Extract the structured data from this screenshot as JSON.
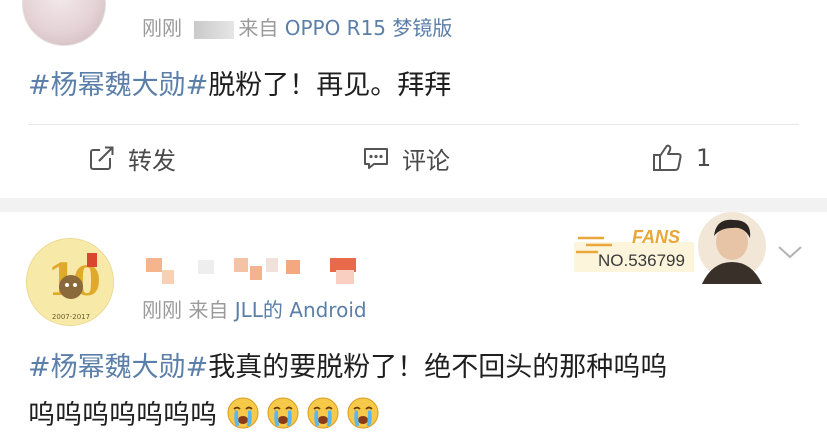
{
  "post1": {
    "time": "刚刚",
    "from_prefix": "来自",
    "device": "OPPO R15 梦镜版",
    "topic": "#杨幂魏大勋#",
    "text": "脱粉了！再见。拜拜",
    "actions": {
      "repost_label": "转发",
      "comment_label": "评论",
      "like_count": "1"
    }
  },
  "post2": {
    "time": "刚刚",
    "from_prefix": "来自",
    "device": "JLL的 Android",
    "avatar_years": "2007-2017",
    "badge": {
      "title": "FANS",
      "number": "NO.536799"
    },
    "topic": "#杨幂魏大勋#",
    "text_line1": "我真的要脱粉了！绝不回头的那种呜呜",
    "text_line2": "呜呜呜呜呜呜呜",
    "emoji_count": 4
  },
  "colors": {
    "link_blue": "#5b7fa8",
    "meta_gray": "#9a9a9a",
    "badge_gold": "#e9a73a",
    "divider": "#e8e8e8"
  },
  "icons": [
    "repost-icon",
    "comment-icon",
    "like-icon",
    "chevron-down-icon",
    "crying-emoji-icon"
  ]
}
